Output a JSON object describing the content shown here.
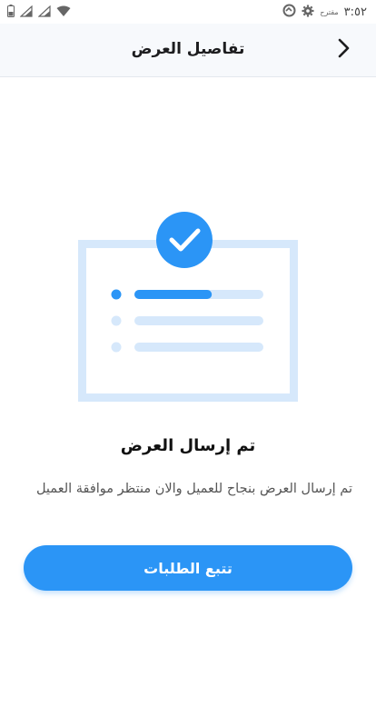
{
  "status_bar": {
    "time": "٣:٥٢",
    "carrier_label": "مقترح",
    "icons": [
      "battery-icon",
      "signal-icon",
      "signal-icon",
      "wifi-icon",
      "settings-icon",
      "sync-icon"
    ]
  },
  "header": {
    "title": "تفاصيل العرض",
    "back_icon": "chevron-right-icon"
  },
  "illustration": {
    "icon": "checkmark-icon",
    "accent_color": "#2b95f6",
    "light_color": "#d6e8fb",
    "progress": 0.6
  },
  "main": {
    "success_title": "تم إرسال العرض",
    "success_message": "تم إرسال العرض بنجاح للعميل والان منتظر موافقة العميل"
  },
  "actions": {
    "track_orders_label": "تتبع الطلبات"
  },
  "colors": {
    "primary": "#2b95f6",
    "header_bg": "#f7f9fc"
  }
}
